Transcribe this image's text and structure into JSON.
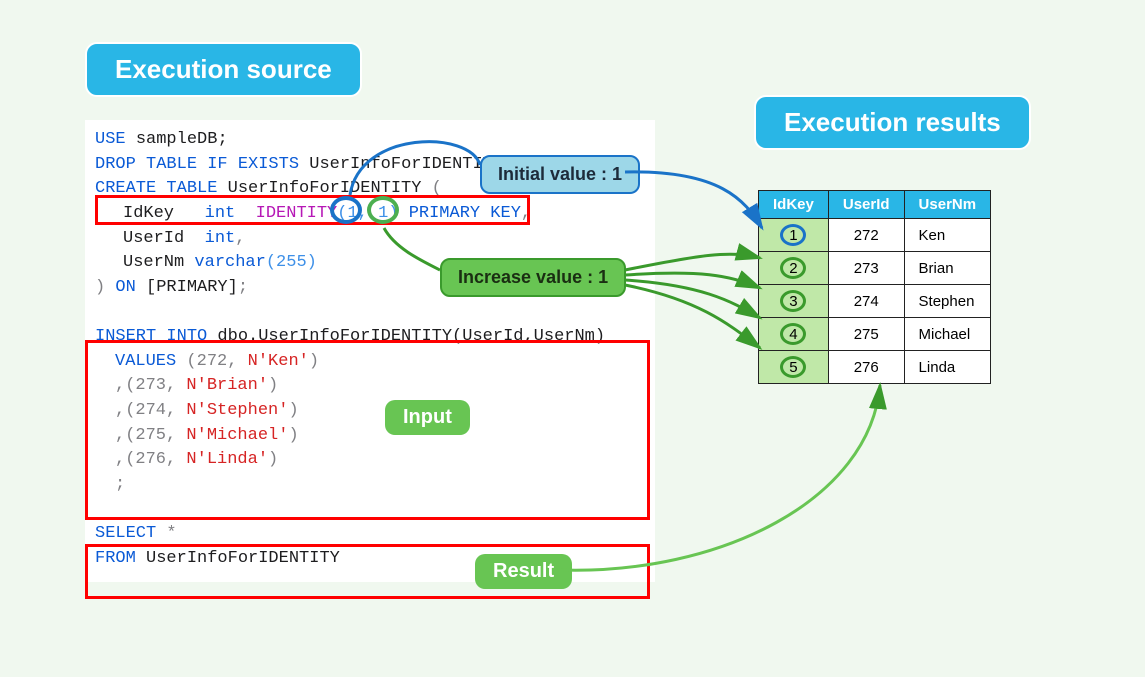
{
  "titles": {
    "source": "Execution source",
    "results": "Execution results"
  },
  "callouts": {
    "initial": "Initial value : 1",
    "increase": "Increase value : 1",
    "input": "Input",
    "result": "Result"
  },
  "sql": {
    "use": "USE",
    "db": "sampleDB",
    "drop": "DROP TABLE IF EXISTS",
    "tbl": "UserInfoForIDENTITY",
    "create": "CREATE TABLE",
    "col1": "IdKey",
    "intkw": "int",
    "identity": "IDENTITY",
    "args": "(1, 1)",
    "pk": "PRIMARY KEY",
    "col2": "UserId",
    "col3": "UserNm",
    "varchar": "varchar",
    "vlen": "(255)",
    "on": "ON",
    "primary": "[PRIMARY]",
    "insert": "INSERT INTO",
    "dbo": "dbo.UserInfoForIDENTITY(UserId,UserNm)",
    "valueskw": "VALUES",
    "v1a": "(272, ",
    "v1b": "N'Ken'",
    "v1c": ")",
    "v2a": ",(273, ",
    "v2b": "N'Brian'",
    "v2c": ")",
    "v3a": ",(274, ",
    "v3b": "N'Stephen'",
    "v3c": ")",
    "v4a": ",(275, ",
    "v4b": "N'Michael'",
    "v4c": ")",
    "v5a": ",(276, ",
    "v5b": "N'Linda'",
    "v5c": ")",
    "semicolon": ";",
    "select": "SELECT",
    "star": "*",
    "from": "FROM"
  },
  "table": {
    "headers": [
      "IdKey",
      "UserId",
      "UserNm"
    ],
    "rows": [
      {
        "id": "1",
        "uid": "272",
        "nm": "Ken"
      },
      {
        "id": "2",
        "uid": "273",
        "nm": "Brian"
      },
      {
        "id": "3",
        "uid": "274",
        "nm": "Stephen"
      },
      {
        "id": "4",
        "uid": "275",
        "nm": "Michael"
      },
      {
        "id": "5",
        "uid": "276",
        "nm": "Linda"
      }
    ]
  },
  "chart_data": {
    "type": "table",
    "title": "Execution results",
    "columns": [
      "IdKey",
      "UserId",
      "UserNm"
    ],
    "data": [
      [
        1,
        272,
        "Ken"
      ],
      [
        2,
        273,
        "Brian"
      ],
      [
        3,
        274,
        "Stephen"
      ],
      [
        4,
        275,
        "Michael"
      ],
      [
        5,
        276,
        "Linda"
      ]
    ],
    "identity_seed": 1,
    "identity_increment": 1
  }
}
